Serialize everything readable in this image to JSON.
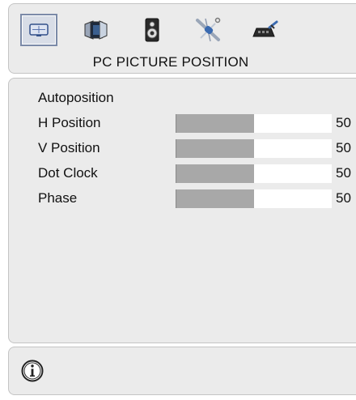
{
  "menu": {
    "title": "PC PICTURE POSITION",
    "icons": [
      {
        "name": "pc-picture-icon",
        "active": true
      },
      {
        "name": "picture-icon",
        "active": false
      },
      {
        "name": "speaker-icon",
        "active": false
      },
      {
        "name": "tools-icon",
        "active": false
      },
      {
        "name": "install-icon",
        "active": false
      }
    ]
  },
  "settings": [
    {
      "label": "Autoposition"
    },
    {
      "label": "H Position",
      "value": "50",
      "level": 0.5
    },
    {
      "label": "V Position",
      "value": "50",
      "level": 0.5
    },
    {
      "label": "Dot Clock",
      "value": "50",
      "level": 0.5
    },
    {
      "label": "Phase",
      "value": "50",
      "level": 0.5
    }
  ],
  "footer": {
    "icon": "info-icon"
  }
}
